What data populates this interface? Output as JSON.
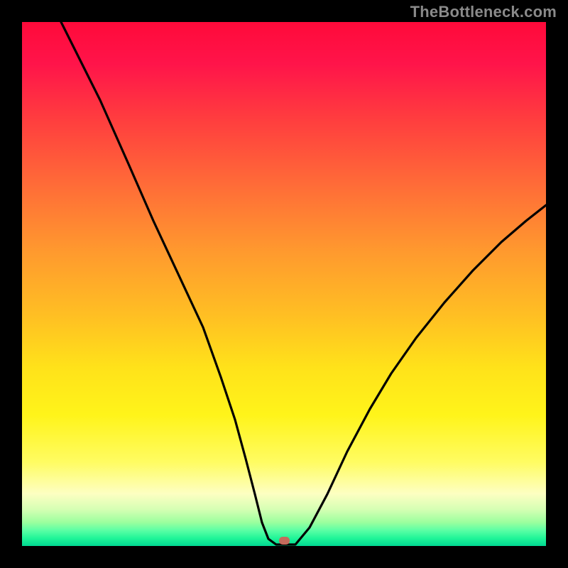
{
  "watermark": "TheBottleneck.com",
  "colors": {
    "frame": "#000000",
    "curve": "#000000",
    "marker": "#c46b5c",
    "watermark": "#8a8a8a"
  },
  "chart_data": {
    "type": "line",
    "title": "",
    "xlabel": "",
    "ylabel": "",
    "xlim": [
      0,
      100
    ],
    "ylim": [
      0,
      100
    ],
    "grid": false,
    "legend": false,
    "x": [
      0,
      7,
      15,
      20,
      25,
      30,
      35,
      38,
      41,
      43,
      45,
      47,
      49,
      52,
      55,
      58,
      62,
      66,
      70,
      75,
      80,
      85,
      90,
      95,
      100
    ],
    "values": [
      100,
      87,
      72,
      62,
      52,
      42,
      32,
      24,
      16,
      10,
      5,
      1,
      0,
      0,
      4,
      10,
      18,
      26,
      33,
      40,
      47,
      53,
      58,
      62,
      65
    ],
    "marker": {
      "x": 50,
      "y": 0
    },
    "background_gradient": {
      "orientation": "vertical",
      "stops": [
        {
          "pos": 0.0,
          "color": "#ff0a3a"
        },
        {
          "pos": 0.32,
          "color": "#ff6f37"
        },
        {
          "pos": 0.66,
          "color": "#ffe21a"
        },
        {
          "pos": 0.9,
          "color": "#fdffc2"
        },
        {
          "pos": 1.0,
          "color": "#00d892"
        }
      ]
    }
  }
}
